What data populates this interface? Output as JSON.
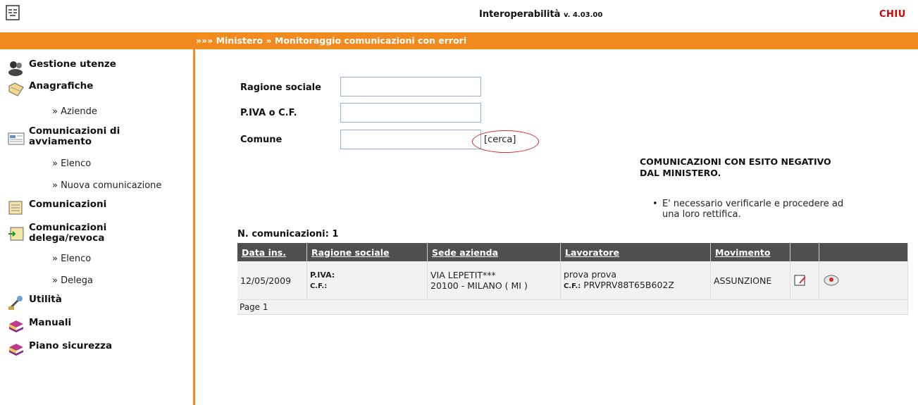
{
  "header": {
    "app_title": "Interoperabilità",
    "version": "v. 4.03.00",
    "close_label": "CHIU"
  },
  "breadcrumb": {
    "text": "»»» Ministero » Monitoraggio comunicazioni con errori"
  },
  "sidebar": {
    "items": [
      {
        "label": "Gestione utenze",
        "icon": "users-icon"
      },
      {
        "label": "Anagrafiche",
        "icon": "folder-icon"
      },
      {
        "label": "» Aziende"
      },
      {
        "label_line1": "Comunicazioni di",
        "label_line2": "avviamento",
        "icon": "document-icon"
      },
      {
        "label": "» Elenco"
      },
      {
        "label": "» Nuova comunicazione"
      },
      {
        "label": "Comunicazioni",
        "icon": "document-icon"
      },
      {
        "label_line1": "Comunicazioni",
        "label_line2": "delega/revoca",
        "icon": "document-arrow-icon"
      },
      {
        "label": "» Elenco"
      },
      {
        "label": "» Delega"
      },
      {
        "label": "Utilità",
        "icon": "tools-icon"
      },
      {
        "label": "Manuali",
        "icon": "books-icon"
      },
      {
        "label": "Piano sicurezza",
        "icon": "books-icon"
      }
    ]
  },
  "form": {
    "ragione_sociale_label": "Ragione sociale",
    "piva_label": "P.IVA o C.F.",
    "comune_label": "Comune",
    "cerca_label": "[cerca]"
  },
  "notice": {
    "title_line1": "COMUNICAZIONI CON ESITO NEGATIVO",
    "title_line2": "DAL MINISTERO.",
    "bullet_line1": "E' necessario verificarle e procedere ad",
    "bullet_line2": "una loro rettifica."
  },
  "results": {
    "count_label": "N. comunicazioni: 1",
    "columns": [
      "Data ins.",
      "Ragione sociale",
      "Sede azienda",
      "Lavoratore",
      "Movimento"
    ],
    "row": {
      "data": "12/05/2009",
      "piva_label": "P.IVA:",
      "cf_label": "C.F.:",
      "sede_line1": "VIA LEPETIT***",
      "sede_line2": "20100 - MILANO ( MI )",
      "lavoratore_name": "prova prova",
      "lavoratore_cf_label": "C.F.:",
      "lavoratore_cf": "PRVPRV88T65B602Z",
      "movimento": "ASSUNZIONE"
    },
    "pager": "Page 1"
  }
}
